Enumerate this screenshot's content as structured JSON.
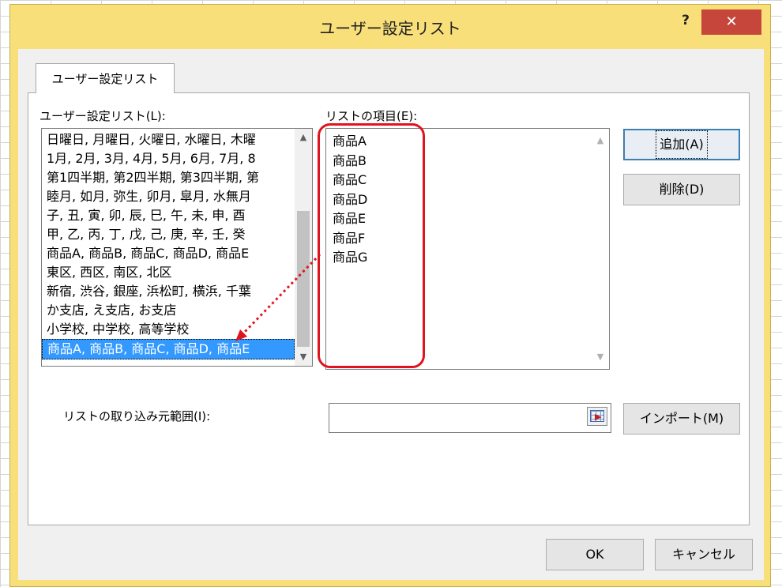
{
  "dialog": {
    "title": "ユーザー設定リスト",
    "help_label": "?",
    "close_label": "✕"
  },
  "tab": {
    "label": "ユーザー設定リスト"
  },
  "custom_lists": {
    "label": "ユーザー設定リスト(L):",
    "items": [
      "日曜日, 月曜日, 火曜日, 水曜日, 木曜",
      "1月, 2月, 3月, 4月, 5月, 6月, 7月, 8",
      "第1四半期, 第2四半期, 第3四半期, 第",
      "睦月, 如月, 弥生, 卯月, 皐月, 水無月",
      "子, 丑, 寅, 卯, 辰, 巳, 午, 未, 申, 酉",
      "甲, 乙, 丙, 丁, 戊, 己, 庚, 辛, 壬, 癸",
      "商品A, 商品B, 商品C, 商品D, 商品E",
      "東区, 西区, 南区, 北区",
      "新宿, 渋谷, 銀座, 浜松町, 横浜, 千葉",
      "か支店, え支店, お支店",
      "小学校, 中学校, 高等学校",
      "商品A, 商品B, 商品C, 商品D, 商品E"
    ],
    "selected_index": 11
  },
  "list_entries": {
    "label": "リストの項目(E):",
    "items": [
      "商品A",
      "商品B",
      "商品C",
      "商品D",
      "商品E",
      "商品F",
      "商品G"
    ]
  },
  "buttons": {
    "add": "追加(A)",
    "delete": "削除(D)",
    "import": "インポート(M)",
    "ok": "OK",
    "cancel": "キャンセル"
  },
  "import_range": {
    "label": "リストの取り込み元範囲(I):",
    "value": ""
  },
  "colors": {
    "title_bar": "#f8df7a",
    "close_button": "#c7463b",
    "selection": "#3399ff",
    "annotation": "#e0141e"
  }
}
